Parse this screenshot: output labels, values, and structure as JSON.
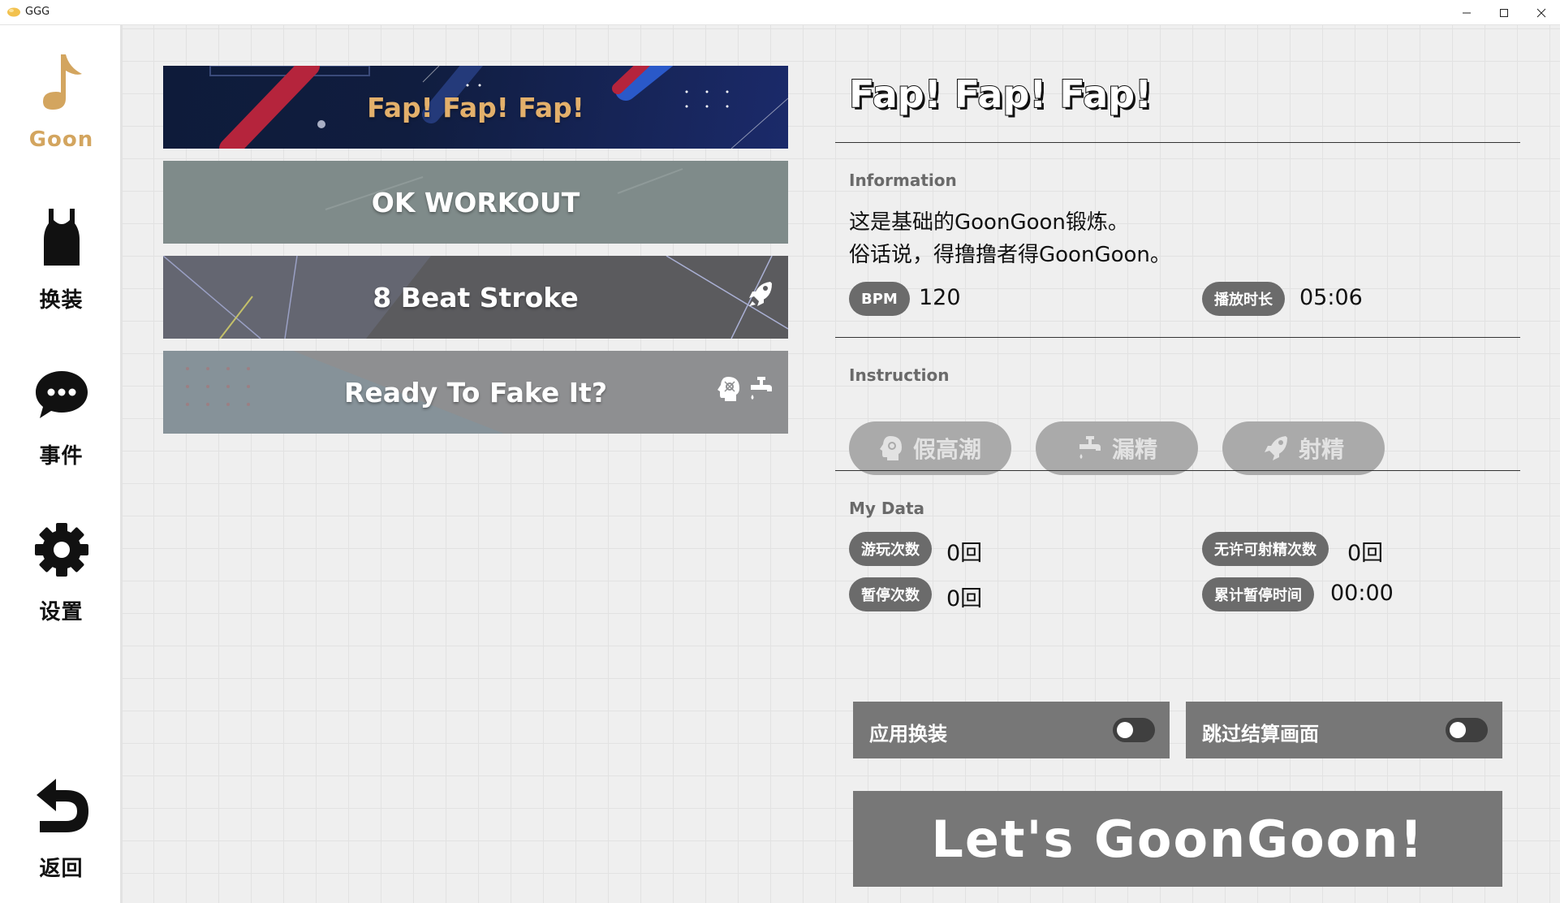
{
  "window": {
    "title": "GGG",
    "controls": [
      "minimize-icon",
      "maximize-icon",
      "close-icon"
    ]
  },
  "sidebar": {
    "items": [
      {
        "label": "Goon",
        "icon": "music-note-icon",
        "active": true
      },
      {
        "label": "换装",
        "icon": "tank-top-icon",
        "active": false
      },
      {
        "label": "事件",
        "icon": "chat-bubble-icon",
        "active": false
      },
      {
        "label": "设置",
        "icon": "gear-icon",
        "active": false
      },
      {
        "label": "返回",
        "icon": "back-arrow-icon",
        "active": false
      }
    ]
  },
  "songs": [
    {
      "title": "Fap! Fap! Fap!",
      "selected": true,
      "icons": []
    },
    {
      "title": "OK WORKOUT",
      "selected": false,
      "icons": []
    },
    {
      "title": "8 Beat Stroke",
      "selected": false,
      "icons": [
        "rocket-icon"
      ]
    },
    {
      "title": "Ready To Fake It?",
      "selected": false,
      "icons": [
        "head-brain-icon",
        "faucet-icon"
      ]
    }
  ],
  "detail": {
    "title": "Fap! Fap! Fap!",
    "information": {
      "label": "Information",
      "line1": "这是基础的GoonGoon锻炼。",
      "line2": "俗话说，得撸撸者得GoonGoon。",
      "bpm_label": "BPM",
      "bpm_value": "120",
      "duration_label": "播放时长",
      "duration_value": "05:06"
    },
    "instruction": {
      "label": "Instruction",
      "buttons": [
        {
          "label": "假高潮",
          "icon": "head-brain-icon"
        },
        {
          "label": "漏精",
          "icon": "faucet-icon"
        },
        {
          "label": "射精",
          "icon": "rocket-icon"
        }
      ]
    },
    "my_data": {
      "label": "My Data",
      "plays_label": "游玩次数",
      "plays_value": "0回",
      "unauthorized_label": "无许可射精次数",
      "unauthorized_value": "0回",
      "pauses_label": "暂停次数",
      "pauses_value": "0回",
      "pause_time_label": "累计暂停时间",
      "pause_time_value": "00:00"
    }
  },
  "toggles": {
    "apply_outfit": {
      "label": "应用换装",
      "on": false
    },
    "skip_result": {
      "label": "跳过结算画面",
      "on": false
    }
  },
  "start_button": {
    "label": "Let's GoonGoon!"
  },
  "colors": {
    "accent": "#d3a55f",
    "pill": "#6b6b6b",
    "panel_gray": "#777777",
    "instruction_disabled": "#aaaaaa"
  }
}
